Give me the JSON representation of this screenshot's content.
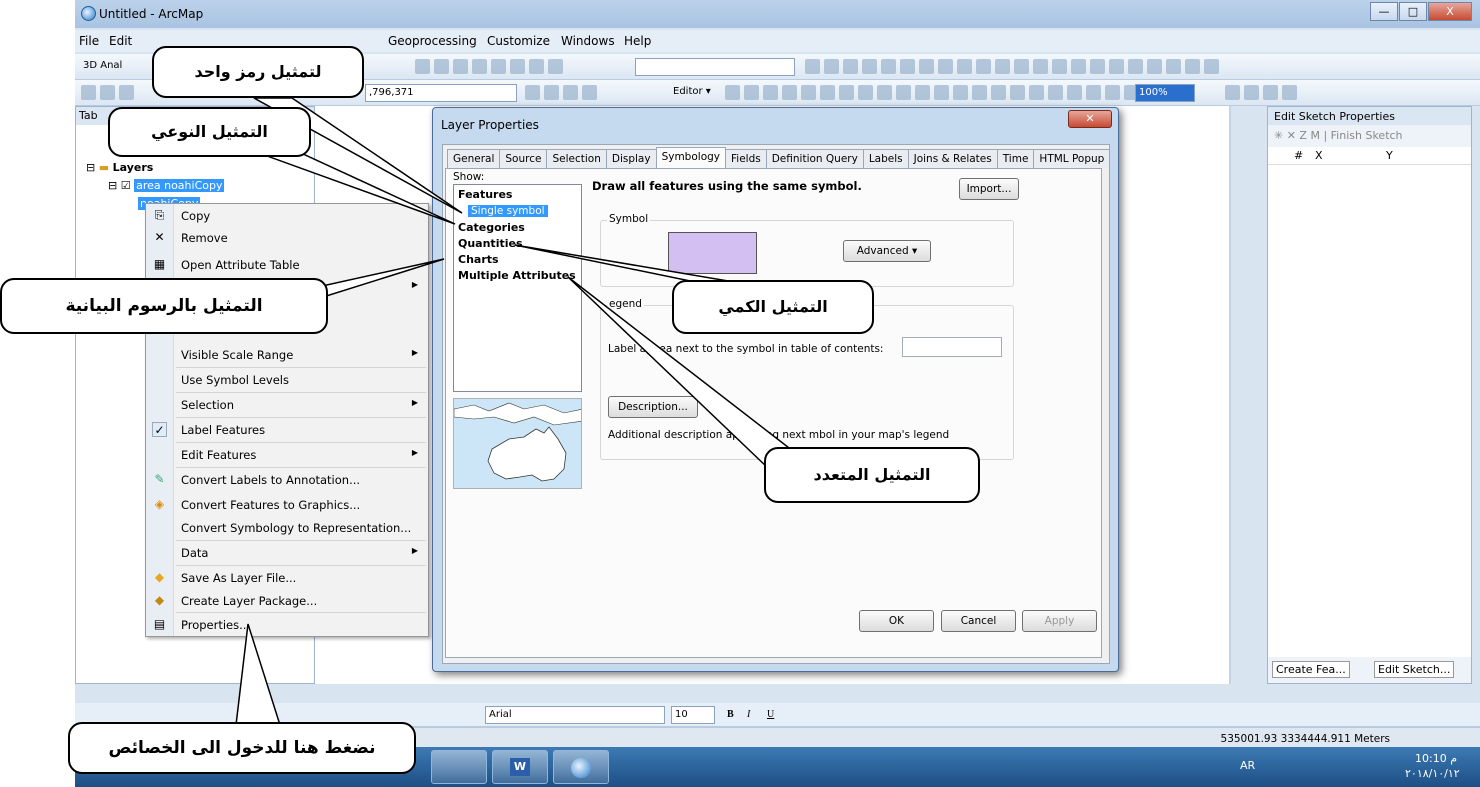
{
  "window": {
    "title": "Untitled - ArcMap",
    "min": "—",
    "max": "□",
    "close": "X"
  },
  "menu": [
    "File",
    "Edit",
    "Geoprocessing",
    "Customize",
    "Windows",
    "Help"
  ],
  "toolbar": {
    "analyst_label": "3D Anal",
    "scale_value": ",796,371",
    "editor_label": "Editor ▾",
    "zoom_value": "100%"
  },
  "toc": {
    "header": "Tab",
    "layers_label": "Layers",
    "layer1": "area noahiCopy",
    "layer2": "noahiCopy"
  },
  "context_menu": {
    "items": [
      {
        "label": "Copy",
        "icon": "copy-icon"
      },
      {
        "label": "Remove",
        "icon": "remove-icon"
      },
      {
        "label": "Open Attribute Table",
        "icon": "table-icon"
      },
      {
        "label": "",
        "icon": ""
      },
      {
        "label": "Visible Scale Range",
        "icon": ""
      },
      {
        "label": "Use Symbol Levels",
        "icon": ""
      },
      {
        "label": "Selection",
        "icon": ""
      },
      {
        "label": "Label Features",
        "icon": "check-icon"
      },
      {
        "label": "Edit Features",
        "icon": ""
      },
      {
        "label": "Convert Labels to Annotation...",
        "icon": "annotation-icon"
      },
      {
        "label": "Convert Features to Graphics...",
        "icon": "graphics-icon"
      },
      {
        "label": "Convert Symbology to Representation...",
        "icon": ""
      },
      {
        "label": "Data",
        "icon": ""
      },
      {
        "label": "Save As Layer File...",
        "icon": "layer-file-icon"
      },
      {
        "label": "Create Layer Package...",
        "icon": "package-icon"
      },
      {
        "label": "Properties...",
        "icon": "properties-icon"
      }
    ]
  },
  "dialog": {
    "title": "Layer Properties",
    "tabs": [
      "General",
      "Source",
      "Selection",
      "Display",
      "Symbology",
      "Fields",
      "Definition Query",
      "Labels",
      "Joins & Relates",
      "Time",
      "HTML Popup"
    ],
    "active_tab": "Symbology",
    "show_label": "Show:",
    "show_items": {
      "features": "Features",
      "single_symbol": "Single symbol",
      "categories": "Categories",
      "quantities": "Quantities",
      "charts": "Charts",
      "multiple_attributes": "Multiple Attributes"
    },
    "headline": "Draw all features using the same symbol.",
    "import_button": "Import...",
    "symbol_group": "Symbol",
    "symbol_color": "#d3bff2",
    "advanced_button": "Advanced",
    "legend_group": "egend",
    "legend_text": "Label appea    next to the symbol in table of contents:",
    "description_button": "Description...",
    "additional_text": "Additional description appearing next            mbol in your map's legend",
    "ok_button": "OK",
    "cancel_button": "Cancel",
    "apply_button": "Apply"
  },
  "right_panel": {
    "title": "Edit Sketch Properties",
    "finish_sketch": "Finish Sketch",
    "col_num": "#",
    "col_x": "X",
    "col_y": "Y",
    "tab1": "Create Fea...",
    "tab2": "Edit Sketch..."
  },
  "drawing_toolbar": {
    "font_name": "Arial",
    "font_size": "10",
    "bold": "B",
    "italic": "I",
    "underline": "U"
  },
  "status": {
    "coords": "535001.93  3334444.911 Meters"
  },
  "taskbar": {
    "lang": "AR",
    "time": "10:10 م",
    "date": "٢٠١٨/١٠/١٢"
  },
  "callouts": {
    "single_symbol": "لتمثيل رمز واحد",
    "categories": "التمثيل النوعي",
    "charts": "التمثيل بالرسوم البيانية",
    "quantities": "التمثيل الكمي",
    "multiple": "التمثيل المتعدد",
    "properties": "نضغط هنا للدخول الى الخصائص"
  }
}
